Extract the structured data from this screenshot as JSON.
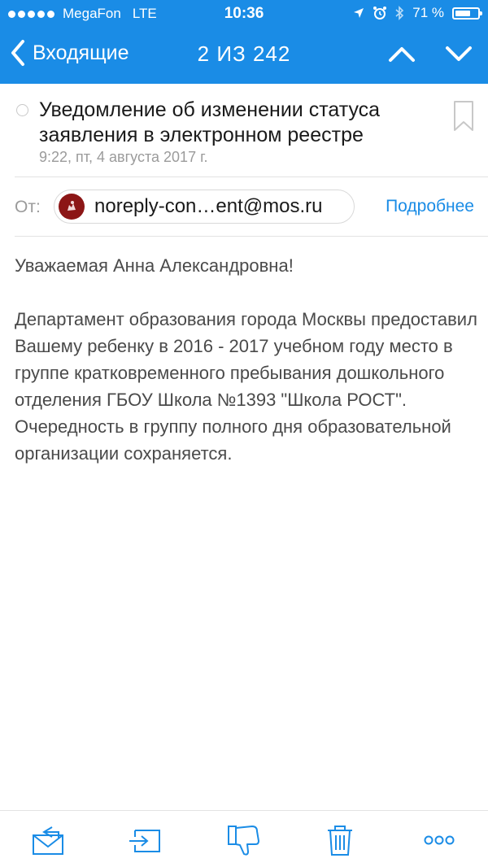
{
  "status_bar": {
    "carrier": "MegaFon",
    "network": "LTE",
    "time": "10:36",
    "battery_percent": "71 %",
    "battery_level": 0.71,
    "icons": [
      "location-arrow-icon",
      "alarm-icon",
      "bluetooth-icon"
    ]
  },
  "nav": {
    "back_label": "Входящие",
    "counter": "2 ИЗ 242"
  },
  "message": {
    "subject": "Уведомление об изменении статуса заявления в электронном реестре",
    "date": "9:22, пт, 4 августа 2017 г.",
    "from_label": "От:",
    "sender": "noreply-con…ent@mos.ru",
    "details_label": "Подробнее",
    "greeting": "Уважаемая Анна Александровна!",
    "body": "Департамент образования города Москвы предоставил Вашему ребенку в 2016 - 2017 учебном году место в группе кратковременного пребывания дошкольного отделения ГБОУ Школа №1393 \"Школа РОСТ\". Очередность в группу полного дня образовательной организации сохраняется."
  },
  "toolbar": {
    "items": [
      "reply-icon",
      "move-to-folder-icon",
      "spam-icon",
      "trash-icon",
      "more-icon"
    ]
  },
  "colors": {
    "accent": "#1a8ce6",
    "body_text": "#4a4a4a",
    "muted_text": "#9b9b9b",
    "avatar": "#8c1616"
  }
}
